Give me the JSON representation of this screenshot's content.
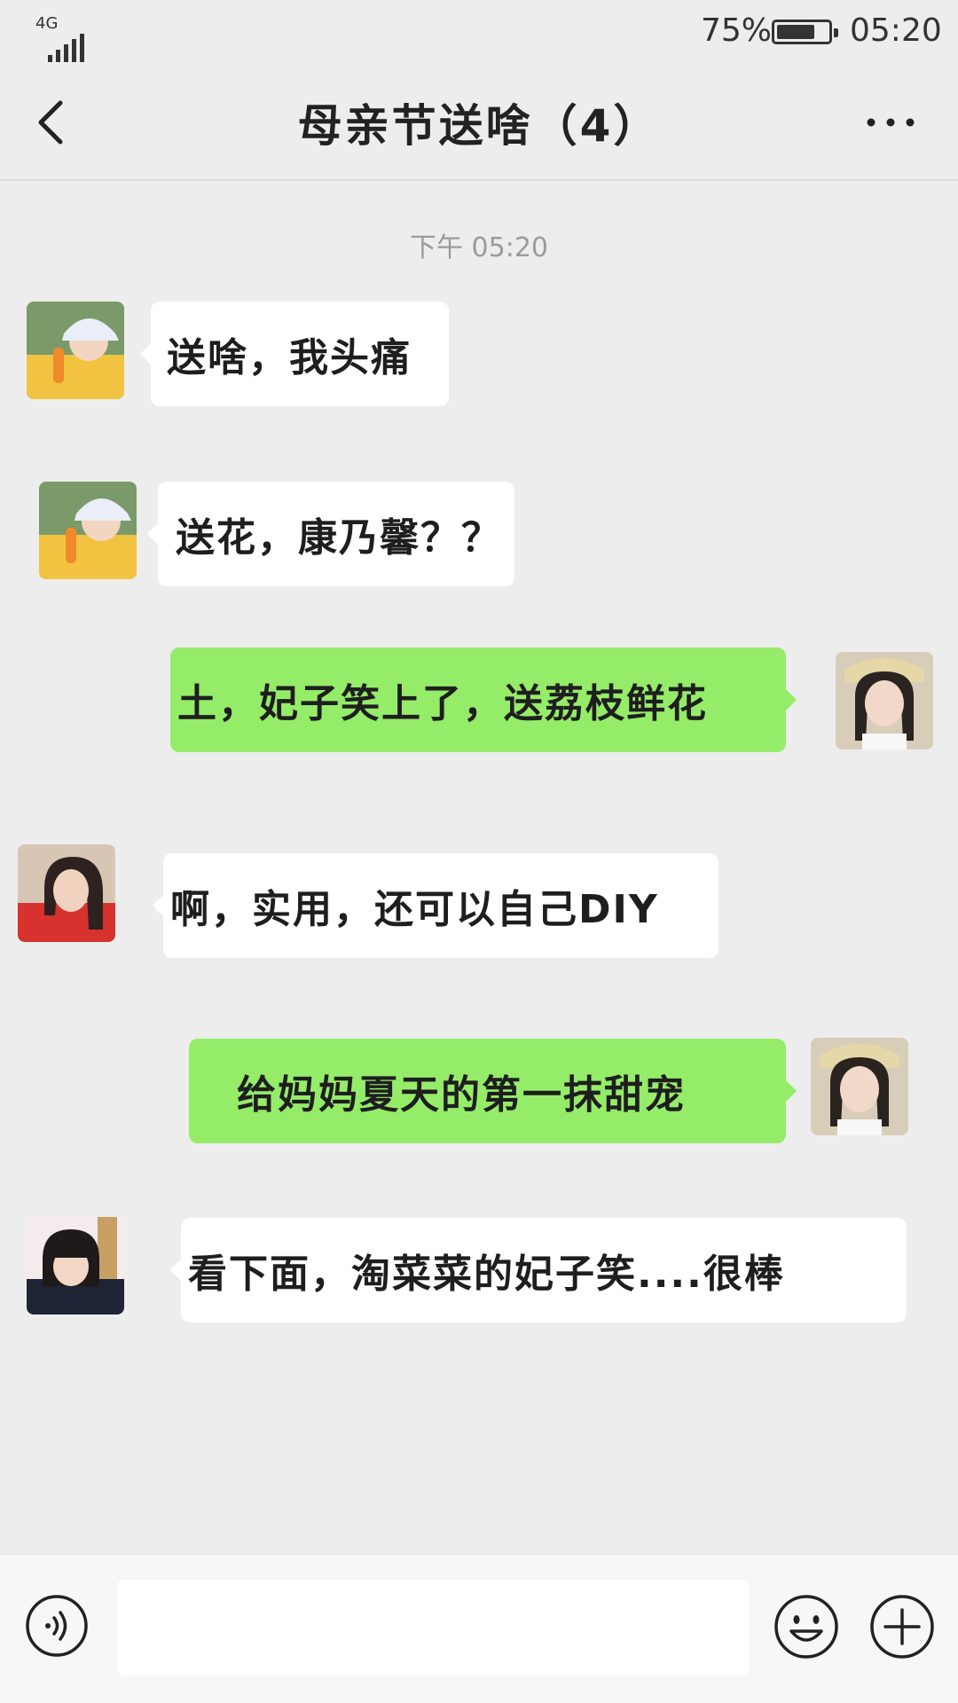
{
  "status_bar": {
    "network": "4G",
    "battery_percent_text": "75%",
    "battery_level": 0.75,
    "time": "05:20"
  },
  "header": {
    "title": "母亲节送啥（4）",
    "back_icon": "chevron-left-icon",
    "more_icon": "more-dots-icon"
  },
  "timestamp": "下午 05:20",
  "messages": [
    {
      "side": "in",
      "avatar": "avatar-girl-bucket-hat",
      "text": "送啥，我头痛"
    },
    {
      "side": "in",
      "avatar": "avatar-girl-bucket-hat",
      "text": "送花，康乃馨？？"
    },
    {
      "side": "out",
      "avatar": "avatar-girl-braids",
      "text": "土，妃子笑上了，送荔枝鲜花"
    },
    {
      "side": "in",
      "avatar": "avatar-girl-red-dress",
      "text": "啊，实用，还可以自己DIY"
    },
    {
      "side": "out",
      "avatar": "avatar-girl-braids",
      "text": "给妈妈夏天的第一抹甜宠"
    },
    {
      "side": "in",
      "avatar": "avatar-girl-bangs",
      "text": "看下面，淘菜菜的妃子笑....很棒"
    }
  ],
  "input_bar": {
    "voice_icon": "voice-icon",
    "input_value": "",
    "emoji_icon": "emoji-icon",
    "plus_icon": "plus-circle-icon"
  },
  "colors": {
    "background": "#ededed",
    "incoming_bubble": "#ffffff",
    "outgoing_bubble": "#95ec69"
  }
}
